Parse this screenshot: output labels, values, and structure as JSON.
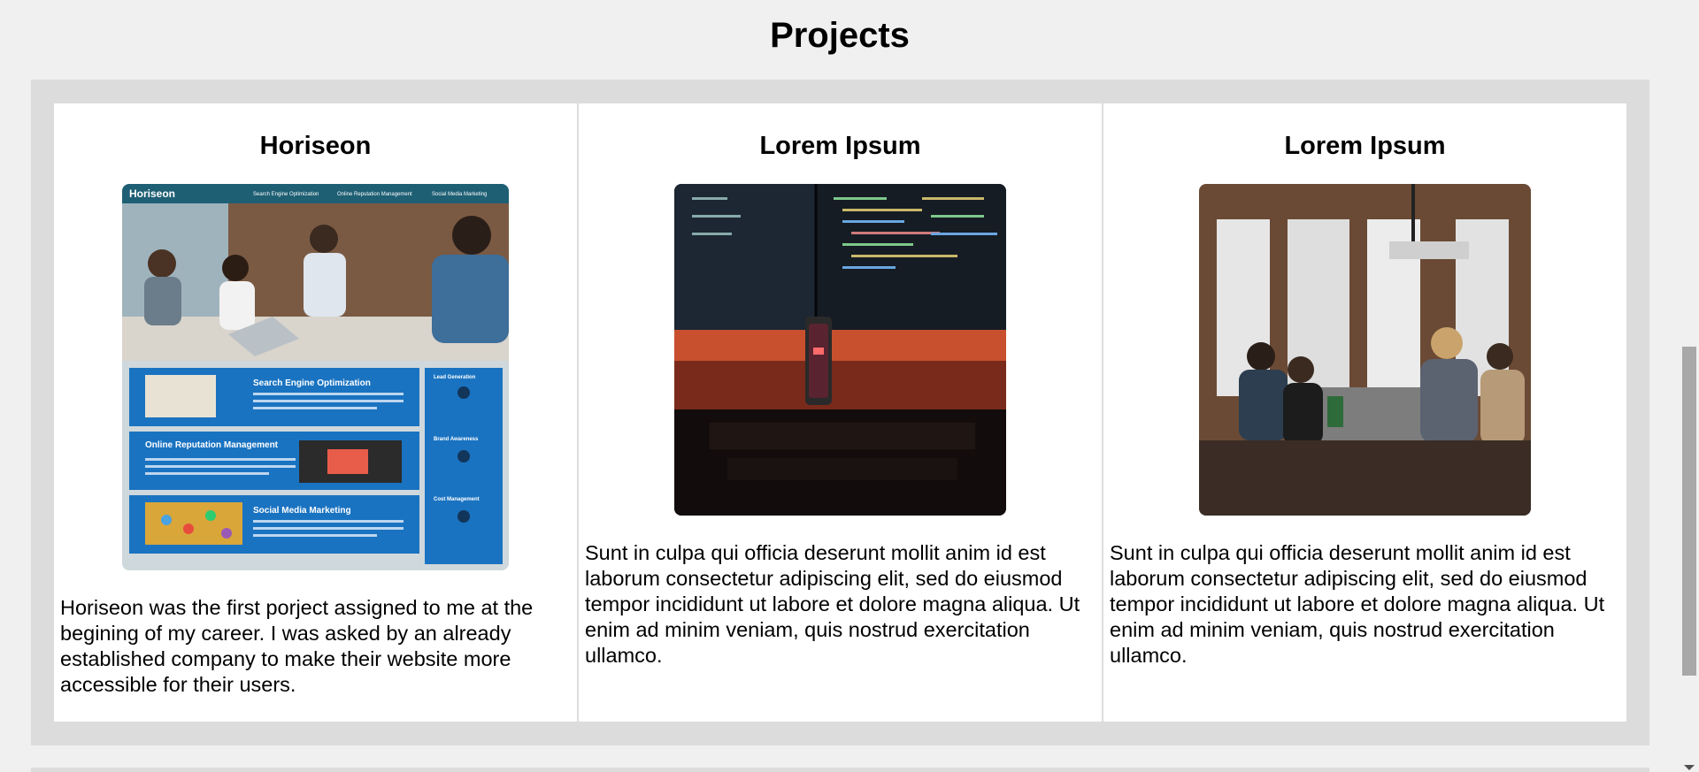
{
  "section": {
    "title": "Projects"
  },
  "projects": [
    {
      "title": "Horiseon",
      "image_alt": "Horiseon website screenshot",
      "image_text": {
        "brand": "Horiseon",
        "nav_1": "Search Engine Optimization",
        "nav_2": "Online Reputation Management",
        "nav_3": "Social Media Marketing",
        "block_1": "Search Engine Optimization",
        "block_2": "Online Reputation Management",
        "block_3": "Social Media Marketing",
        "side_1": "Lead Generation",
        "side_2": "Brand Awareness",
        "side_3": "Cost Management"
      },
      "description": "Horiseon was the first porject assigned to me at the begining of my career. I was asked by an already established company to make their website more accessible for their users."
    },
    {
      "title": "Lorem Ipsum",
      "image_alt": "Monitors with code and phone in dark room",
      "description": "Sunt in culpa qui officia deserunt mollit anim id est laborum consectetur adipiscing elit, sed do eiusmod tempor incididunt ut labore et dolore magna aliqua. Ut enim ad minim veniam, quis nostrud exercitation ullamco."
    },
    {
      "title": "Lorem Ipsum",
      "image_alt": "Team meeting around a table",
      "description": "Sunt in culpa qui officia deserunt mollit anim id est laborum consectetur adipiscing elit, sed do eiusmod tempor incididunt ut labore et dolore magna aliqua. Ut enim ad minim veniam, quis nostrud exercitation ullamco."
    }
  ],
  "colors": {
    "page_bg": "#f0f0f0",
    "panel_bg": "#dcdcdc",
    "card_bg": "#ffffff",
    "horiseon_blue": "#1a73c1"
  }
}
